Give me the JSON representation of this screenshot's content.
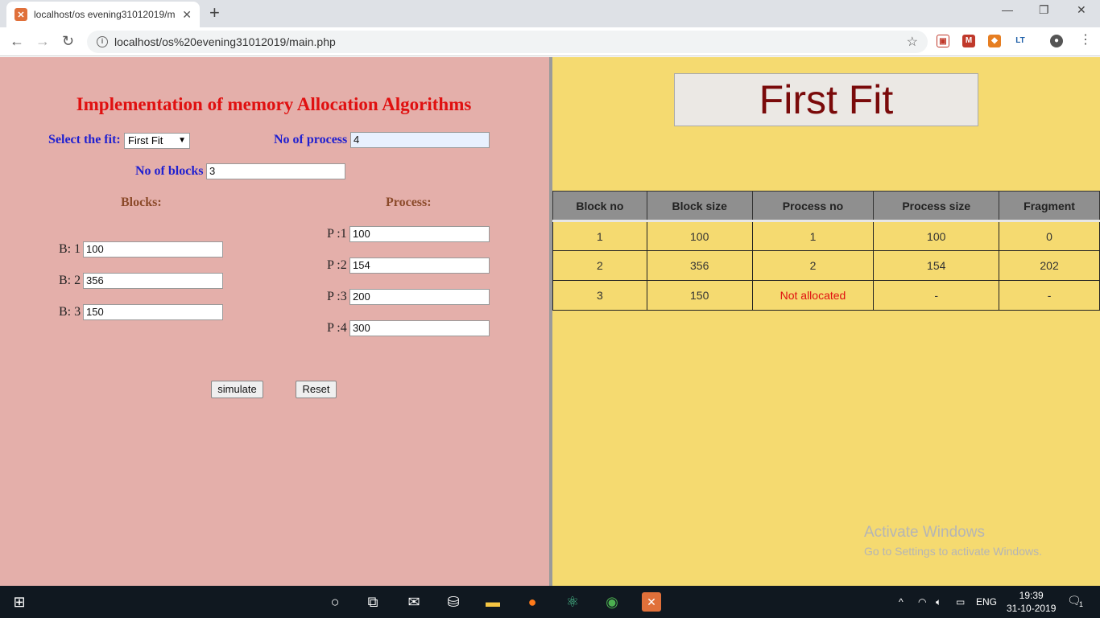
{
  "browser": {
    "tab_title": "localhost/os evening31012019/m",
    "tab_close": "✕",
    "new_tab": "+",
    "url": "localhost/os%20evening31012019/main.php",
    "favicon_color": "#e0703a"
  },
  "left": {
    "heading": "Implementation of memory Allocation Algorithms",
    "select_fit_label": "Select the fit:",
    "select_fit_value": "First Fit",
    "no_process_label": "No of process",
    "no_process_value": "4",
    "no_blocks_label": "No of blocks",
    "no_blocks_value": "3",
    "blocks_header": "Blocks:",
    "process_header": "Process:",
    "blocks": [
      {
        "label": "B: 1",
        "value": "100"
      },
      {
        "label": "B: 2",
        "value": "356"
      },
      {
        "label": "B: 3",
        "value": "150"
      }
    ],
    "processes": [
      {
        "label": "P :1",
        "value": "100"
      },
      {
        "label": "P :2",
        "value": "154"
      },
      {
        "label": "P :3",
        "value": "200"
      },
      {
        "label": "P :4",
        "value": "300"
      }
    ],
    "simulate_label": "simulate",
    "reset_label": "Reset",
    "bg_color": "#e4afaa",
    "heading_color": "#e01010"
  },
  "right": {
    "fit_title": "First Fit",
    "columns": [
      "Block no",
      "Block size",
      "Process no",
      "Process size",
      "Fragment"
    ],
    "rows": [
      [
        "1",
        "100",
        "1",
        "100",
        "0"
      ],
      [
        "2",
        "356",
        "2",
        "154",
        "202"
      ],
      [
        "3",
        "150",
        "Not allocated",
        "-",
        "-"
      ]
    ],
    "watermark_title": "Activate Windows",
    "watermark_sub": "Go to Settings to activate Windows.",
    "bg_color": "#f5da70"
  },
  "taskbar": {
    "lang": "ENG",
    "time": "19:39",
    "date": "31-10-2019",
    "notification_count": "1"
  }
}
